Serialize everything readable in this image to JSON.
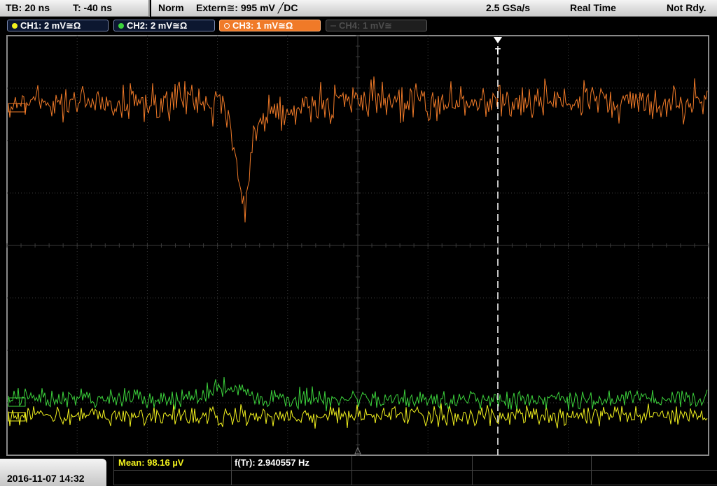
{
  "status_bar": {
    "timebase": "TB: 20 ns",
    "trigger_offset": "T: -40 ns",
    "trigger_mode": "Norm",
    "trigger_source": "Extern≅: 995 mV ╱DC",
    "sample_rate": "2.5 GSa/s",
    "acq_mode": "Real Time",
    "trigger_status": "Not Rdy."
  },
  "channels": [
    {
      "label": "CH1: 2 mV≅Ω",
      "color": "#f2f21e",
      "active": true
    },
    {
      "label": "CH2: 2 mV≅Ω",
      "color": "#3cd33c",
      "active": true
    },
    {
      "label": "CH3: 1 mV≅Ω",
      "color": "#f07a28",
      "active": true
    },
    {
      "label": "CH4: 1 mV≅",
      "color": "#4e4e4e",
      "active": false
    }
  ],
  "scope": {
    "trigger_marker": "T",
    "colors": {
      "ch1": "#f2f21e",
      "ch2": "#3cd33c",
      "ch3": "#f07a28",
      "grid": "#3a3a3a",
      "frame": "#8a8a8a"
    }
  },
  "bottom": {
    "datetime": "2016-11-07 14:32",
    "measurements": [
      {
        "label": "Mean: 98.16 µV",
        "color": "#f2f21e"
      },
      {
        "label": "f(Tr): 2.940557 Hz",
        "color": "#ffffff"
      }
    ]
  }
}
